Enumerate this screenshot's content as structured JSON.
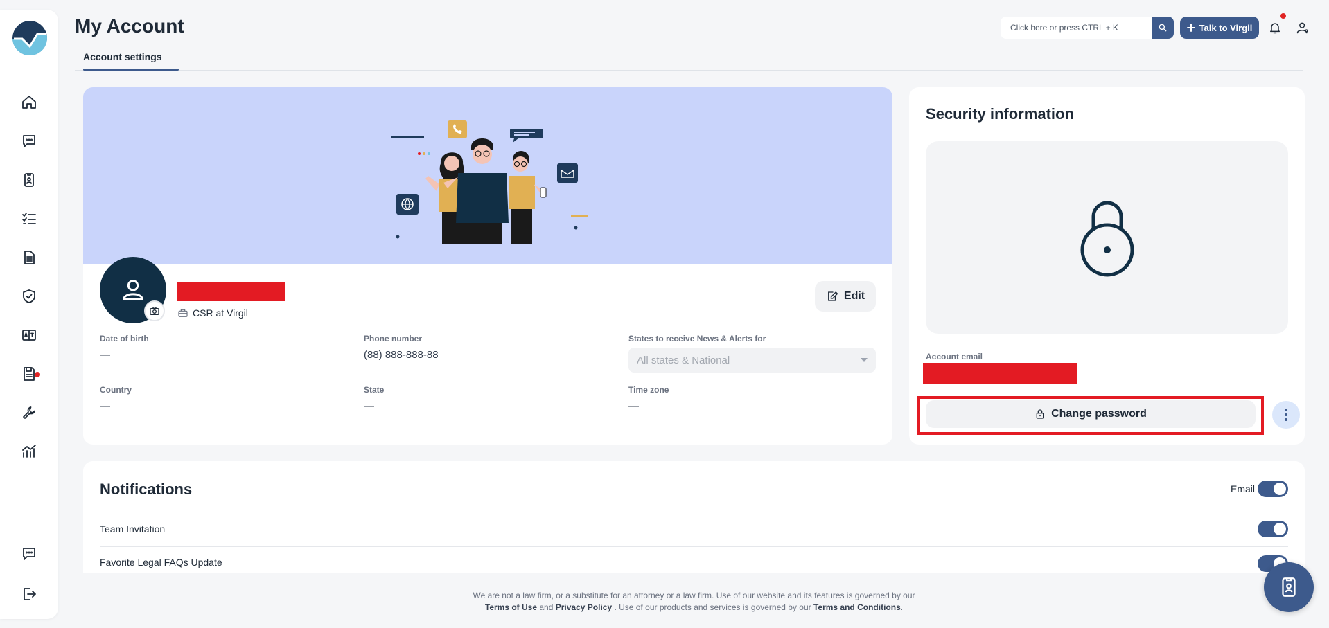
{
  "header": {
    "title": "My Account",
    "search_placeholder": "Click here or press CTRL + K",
    "talk_label": "Talk to Virgil"
  },
  "tabs": [
    {
      "label": "Account settings",
      "active": true
    }
  ],
  "sidebar": {
    "items": [
      {
        "icon": "home-icon"
      },
      {
        "icon": "chat-icon"
      },
      {
        "icon": "id-badge-icon"
      },
      {
        "icon": "checklist-icon"
      },
      {
        "icon": "document-icon"
      },
      {
        "icon": "shield-check-icon"
      },
      {
        "icon": "book-translate-icon"
      },
      {
        "icon": "save-doc-icon",
        "badge": true
      },
      {
        "icon": "wrench-icon"
      },
      {
        "icon": "analytics-icon"
      }
    ],
    "bottom": [
      {
        "icon": "feedback-icon"
      },
      {
        "icon": "logout-icon"
      }
    ]
  },
  "profile": {
    "role": "CSR at Virgil",
    "edit_label": "Edit",
    "fields": {
      "dob_label": "Date of birth",
      "dob_value": "—",
      "phone_label": "Phone number",
      "phone_value": "(88) 888-888-88",
      "states_label": "States to receive News & Alerts for",
      "states_value": "All states & National",
      "country_label": "Country",
      "country_value": "—",
      "state_label": "State",
      "state_value": "—",
      "timezone_label": "Time zone",
      "timezone_value": "—"
    }
  },
  "security": {
    "title": "Security information",
    "email_label": "Account email",
    "change_password_label": "Change password"
  },
  "notifications": {
    "title": "Notifications",
    "email_label": "Email",
    "email_enabled": true,
    "rows": [
      {
        "label": "Team Invitation",
        "enabled": true
      },
      {
        "label": "Favorite Legal FAQs Update",
        "enabled": true
      }
    ]
  },
  "footer": {
    "line1": "We are not a law firm, or a substitute for an attorney or a law firm. Use of our website and its features is governed by our",
    "terms_of_use": "Terms of Use",
    "and": "and",
    "privacy_policy": "Privacy Policy",
    "line2_mid": ". Use of our products and services is governed by our",
    "terms_conditions": "Terms and Conditions",
    "period": "."
  },
  "colors": {
    "primary": "#3d5a8c",
    "avatar_bg": "#112f45",
    "banner_bg": "#c9d4fb",
    "redaction": "#e31b23"
  }
}
